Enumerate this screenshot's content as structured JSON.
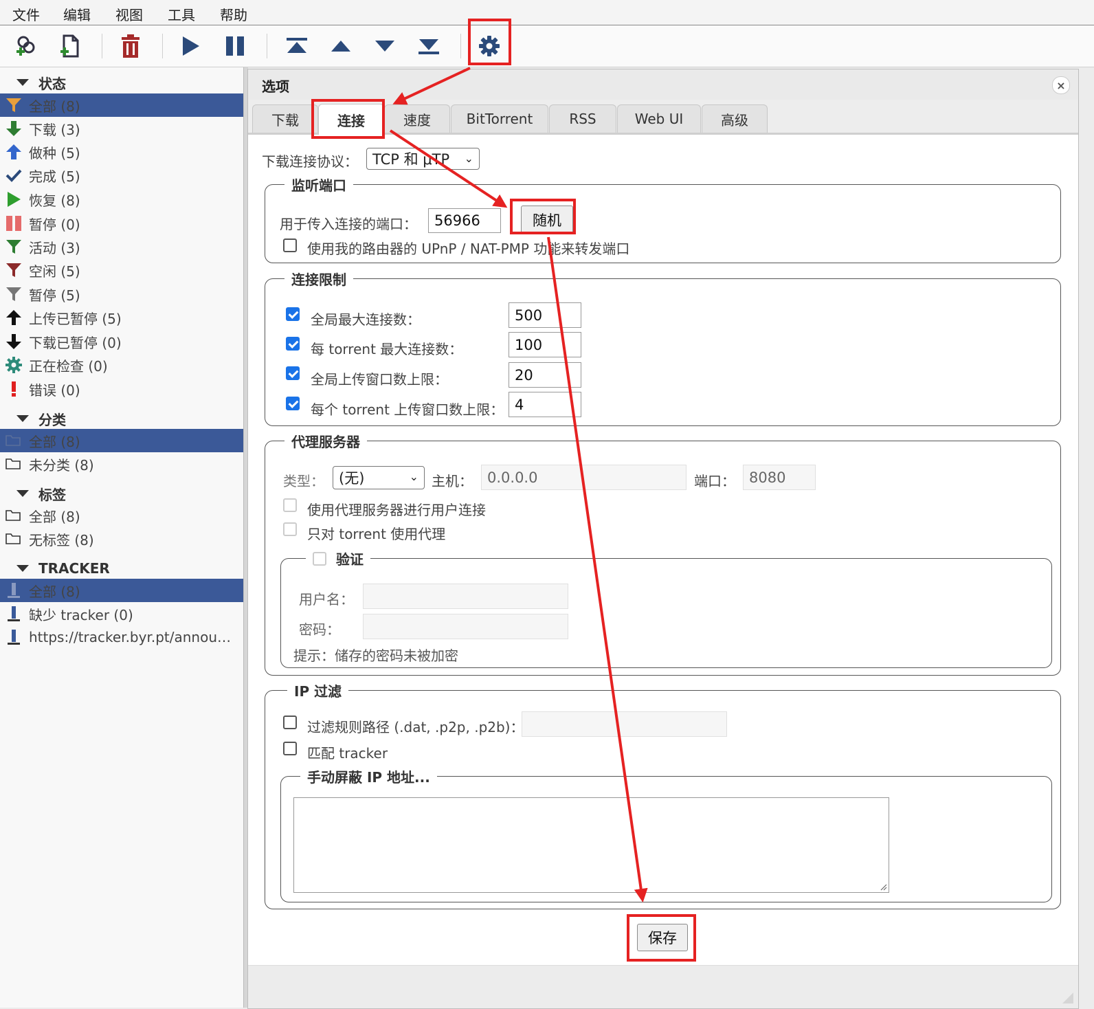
{
  "menu": [
    "文件",
    "编辑",
    "视图",
    "工具",
    "帮助"
  ],
  "sidebar": {
    "status_header": "状态",
    "status_items": [
      "全部 (8)",
      "下载 (3)",
      "做种 (5)",
      "完成 (5)",
      "恢复 (8)",
      "暂停 (0)",
      "活动 (3)",
      "空闲 (5)",
      "暂停 (5)",
      "上传已暂停 (5)",
      "下载已暂停 (0)",
      "正在检查 (0)",
      "错误 (0)"
    ],
    "category_header": "分类",
    "category_items": [
      "全部 (8)",
      "未分类 (8)"
    ],
    "tag_header": "标签",
    "tag_items": [
      "全部 (8)",
      "无标签 (8)"
    ],
    "tracker_header": "TRACKER",
    "tracker_items": [
      "全部 (8)",
      "缺少 tracker (0)",
      "https://tracker.byr.pt/announce.php"
    ]
  },
  "dialog": {
    "title": "选项",
    "close": "×",
    "tabs": [
      "下载",
      "连接",
      "速度",
      "BitTorrent",
      "RSS",
      "Web UI",
      "高级"
    ],
    "protocol_label": "下载连接协议：",
    "protocol_value": "TCP 和 μTP",
    "listen": {
      "legend": "监听端口",
      "port_label": "用于传入连接的端口：",
      "port_value": "56966",
      "random_button": "随机",
      "upnp_label": "使用我的路由器的 UPnP / NAT-PMP 功能来转发端口"
    },
    "limits": {
      "legend": "连接限制",
      "rows": [
        {
          "label": "全局最大连接数：",
          "value": "500"
        },
        {
          "label": "每 torrent 最大连接数：",
          "value": "100"
        },
        {
          "label": "全局上传窗口数上限：",
          "value": "20"
        },
        {
          "label": "每个 torrent 上传窗口数上限：",
          "value": "4"
        }
      ]
    },
    "proxy": {
      "legend": "代理服务器",
      "type_label": "类型：",
      "type_value": "(无)",
      "host_label": "主机：",
      "host_value": "0.0.0.0",
      "port_label": "端口：",
      "port_value": "8080",
      "use_peer_label": "使用代理服务器进行用户连接",
      "torrent_only_label": "只对 torrent 使用代理",
      "auth_legend": "验证",
      "username_label": "用户名：",
      "password_label": "密码：",
      "hint": "提示：储存的密码未被加密"
    },
    "ipfilter": {
      "legend": "IP 过滤",
      "path_label": "过滤规则路径 (.dat, .p2p, .p2b)：",
      "match_tracker_label": "匹配 tracker",
      "manual_legend": "手动屏蔽 IP 地址..."
    },
    "save_button": "保存"
  }
}
